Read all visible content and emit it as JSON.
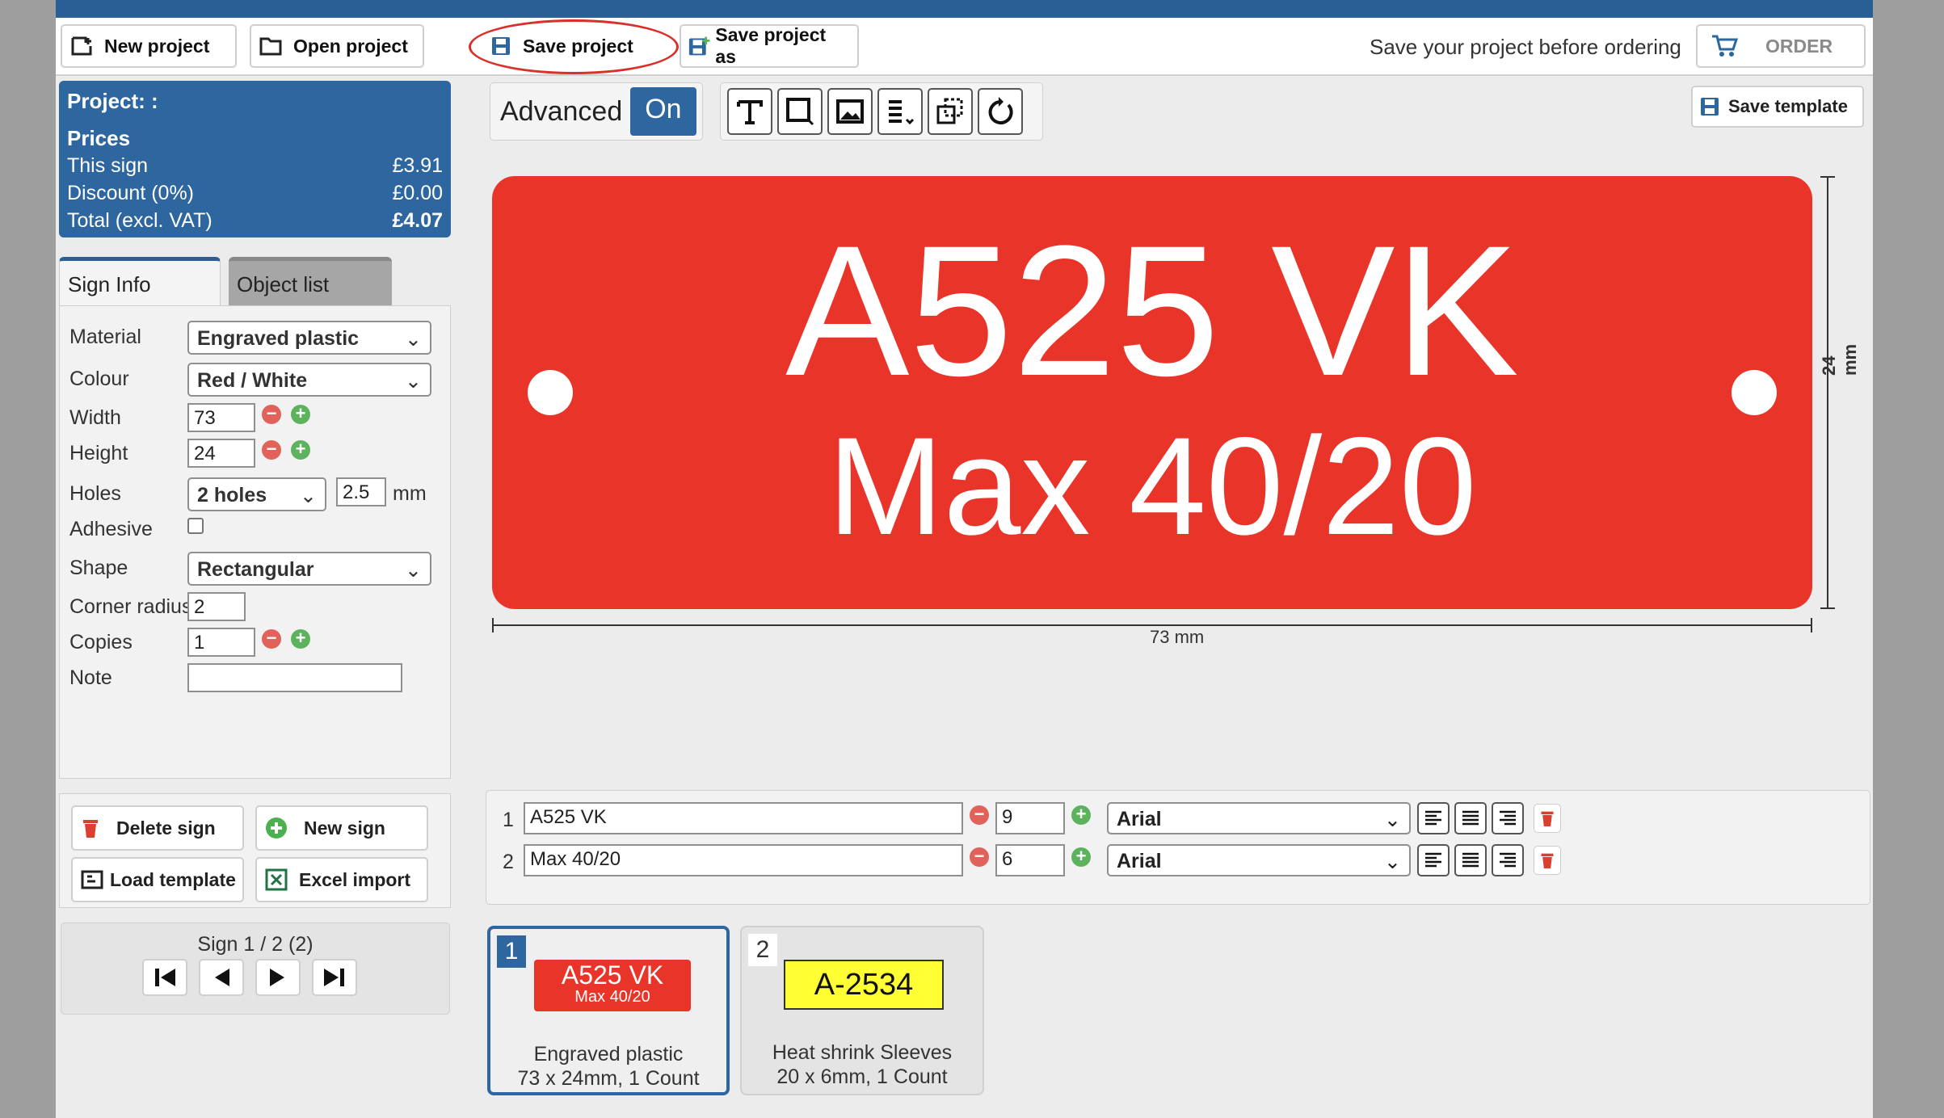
{
  "toolbar": {
    "new_project": "New project",
    "open_project": "Open project",
    "save_project": "Save project",
    "save_project_as": "Save project as",
    "order_note": "Save your project before ordering",
    "order": "ORDER"
  },
  "prices": {
    "project": "Project: :",
    "heading": "Prices",
    "rows": [
      {
        "label": "This sign",
        "value": "£3.91"
      },
      {
        "label": "Discount (0%)",
        "value": "£0.00"
      },
      {
        "label": "Total (excl. VAT)",
        "value": "£4.07"
      }
    ]
  },
  "tabs": {
    "sign_info": "Sign Info",
    "object_list": "Object list"
  },
  "sign_info": {
    "material_label": "Material",
    "material": "Engraved plastic",
    "colour_label": "Colour",
    "colour": "Red / White",
    "width_label": "Width",
    "width": "73",
    "height_label": "Height",
    "height": "24",
    "holes_label": "Holes",
    "holes": "2 holes",
    "hole_size": "2.5",
    "hole_unit": "mm",
    "adhesive_label": "Adhesive",
    "shape_label": "Shape",
    "shape": "Rectangular",
    "corner_label": "Corner radius",
    "corner": "2",
    "copies_label": "Copies",
    "copies": "1",
    "note_label": "Note",
    "note": ""
  },
  "actions": {
    "delete_sign": "Delete sign",
    "new_sign": "New sign",
    "load_template": "Load template",
    "excel_import": "Excel import"
  },
  "nav": {
    "label": "Sign 1 / 2 (2)"
  },
  "editor": {
    "advanced": "Advanced",
    "advanced_state": "On",
    "save_template": "Save template"
  },
  "sign": {
    "line1": "A525 VK",
    "line2": "Max 40/20",
    "width_dim": "73 mm",
    "height_dim": "24 mm",
    "color": "#e93429"
  },
  "text_lines": [
    {
      "num": "1",
      "text": "A525 VK",
      "size": "9",
      "font": "Arial"
    },
    {
      "num": "2",
      "text": "Max 40/20",
      "size": "6",
      "font": "Arial"
    }
  ],
  "cards": [
    {
      "num": "1",
      "preview1": "A525 VK",
      "preview2": "Max 40/20",
      "caption1": "Engraved plastic",
      "caption2": "73 x 24mm, 1 Count"
    },
    {
      "num": "2",
      "preview1": "A-2534",
      "caption1": "Heat shrink Sleeves",
      "caption2": "20 x 6mm, 1 Count"
    }
  ]
}
